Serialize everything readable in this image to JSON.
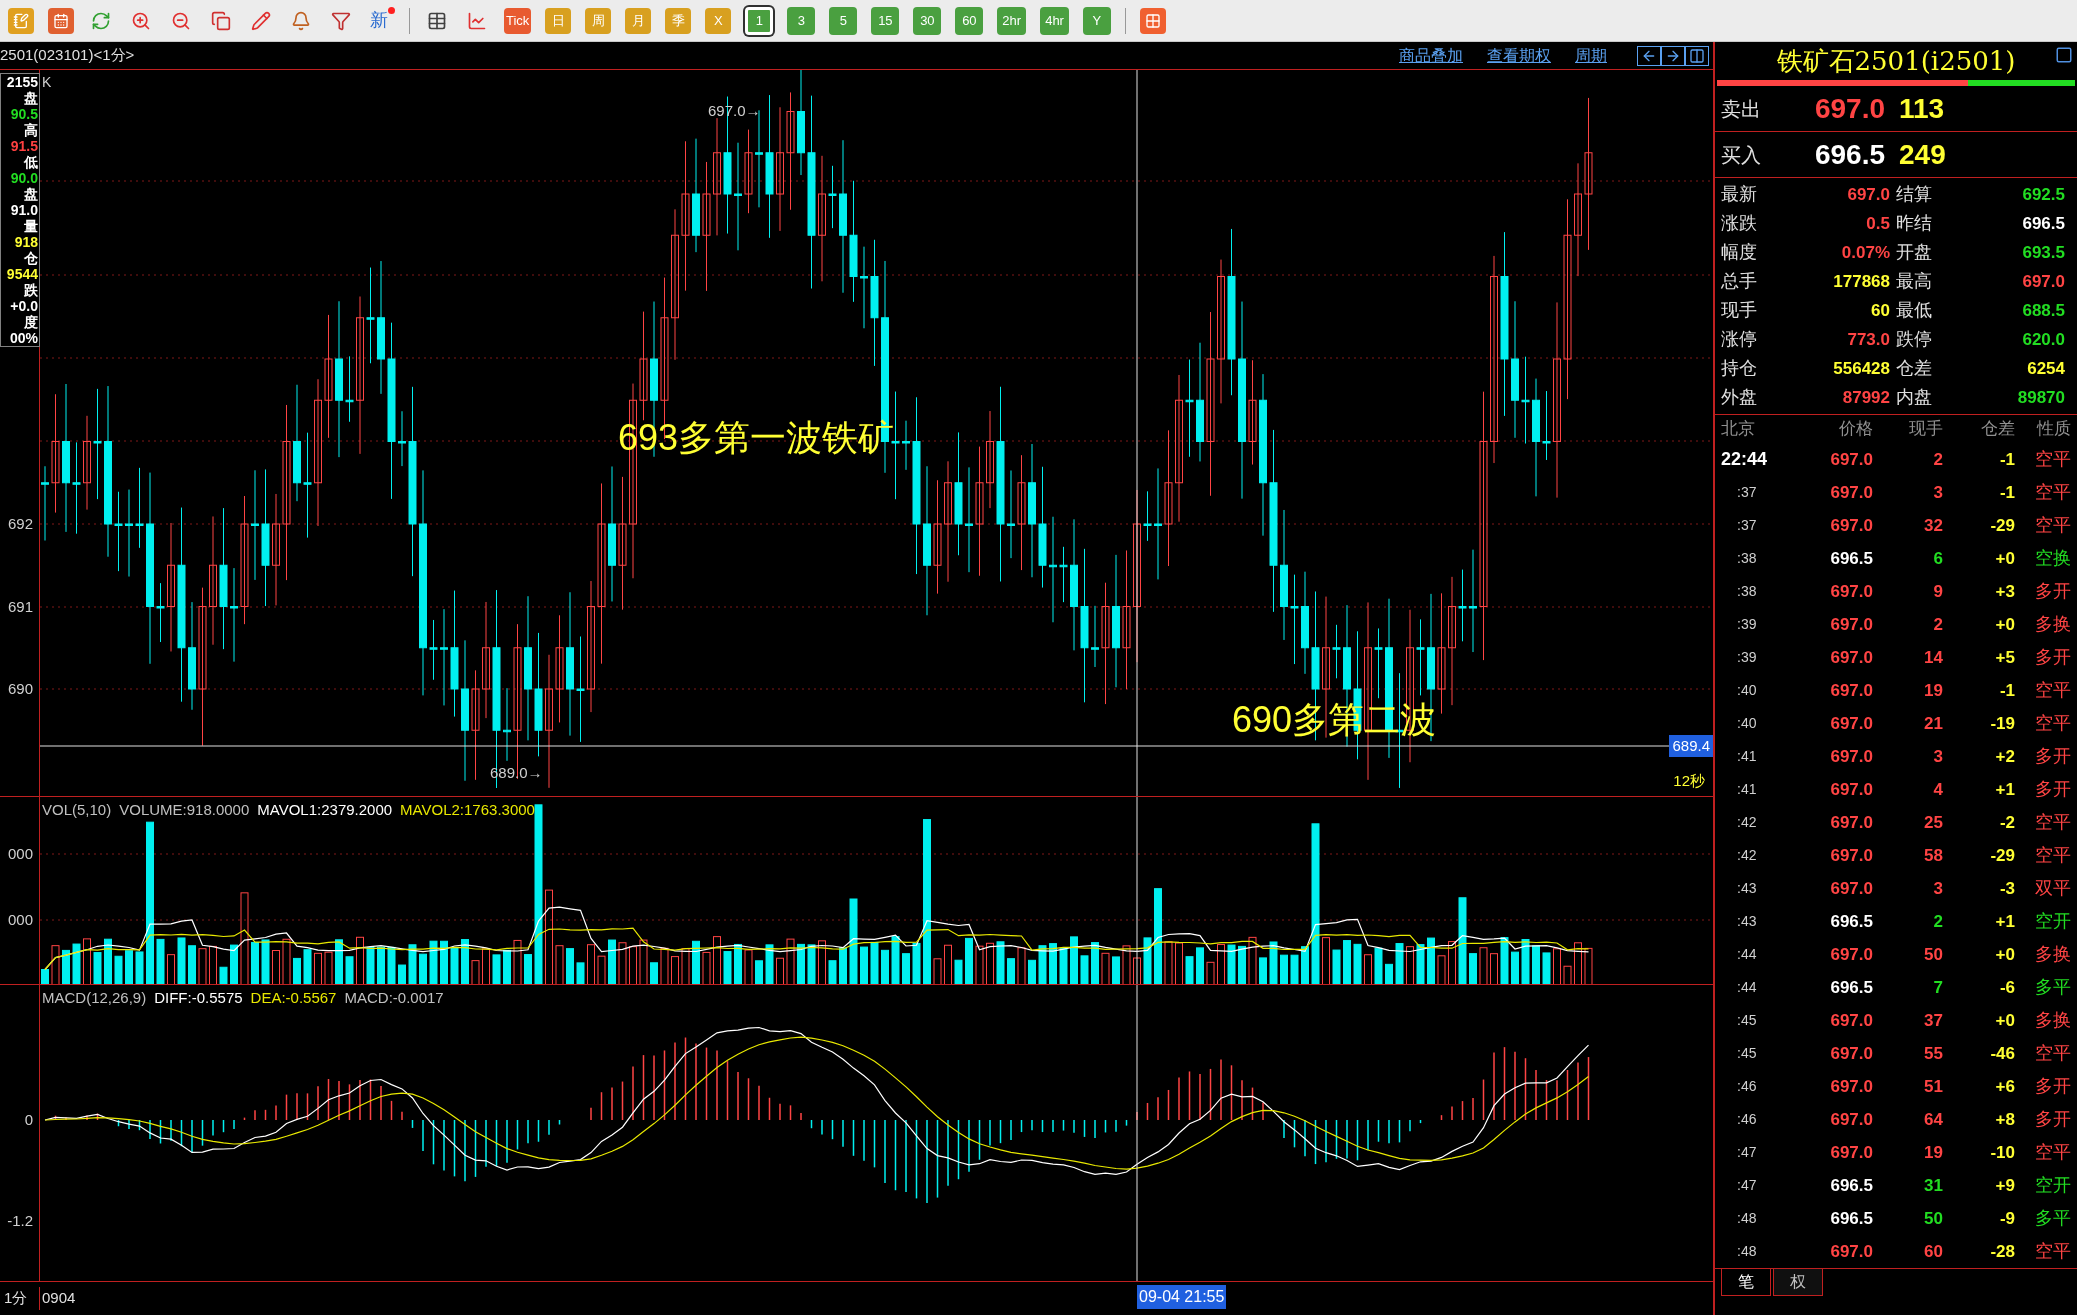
{
  "toolbar": {
    "new_label": "新",
    "chart_buttons": [
      "Tick",
      "日",
      "周",
      "月",
      "季",
      "X"
    ],
    "periods": [
      {
        "label": "1",
        "selected": true
      },
      {
        "label": "3",
        "selected": false
      },
      {
        "label": "5",
        "selected": false
      },
      {
        "label": "15",
        "selected": false
      },
      {
        "label": "30",
        "selected": false
      },
      {
        "label": "60",
        "selected": false
      },
      {
        "label": "2hr",
        "selected": false
      },
      {
        "label": "4hr",
        "selected": false
      },
      {
        "label": "Y",
        "selected": false
      }
    ]
  },
  "chart_header": {
    "symbol": "2501(023101)<1分>",
    "links": [
      "商品叠加",
      "查看期权",
      "周期"
    ]
  },
  "price_panel": {
    "label": "K",
    "info": [
      {
        "text": "2155",
        "color": "#ffffff"
      },
      {
        "text": "盘",
        "color": "#ffffff"
      },
      {
        "text": "90.5",
        "color": "#22dd22"
      },
      {
        "text": "高",
        "color": "#ffffff"
      },
      {
        "text": "91.5",
        "color": "#ff4040"
      },
      {
        "text": "低",
        "color": "#ffffff"
      },
      {
        "text": "90.0",
        "color": "#22dd22"
      },
      {
        "text": "盘",
        "color": "#ffffff"
      },
      {
        "text": "91.0",
        "color": "#ffffff"
      },
      {
        "text": "量",
        "color": "#ffffff"
      },
      {
        "text": "918",
        "color": "#ffff33"
      },
      {
        "text": "仓",
        "color": "#ffffff"
      },
      {
        "text": "9544",
        "color": "#ffff33"
      },
      {
        "text": "跌",
        "color": "#ffffff"
      },
      {
        "text": "+0.0",
        "color": "#ffffff"
      },
      {
        "text": "度",
        "color": "#ffffff"
      },
      {
        "text": "00%",
        "color": "#ffffff"
      }
    ],
    "axis_labels": [
      "692",
      "691",
      "690"
    ],
    "high_marker": "697.0→",
    "low_marker": "689.0→",
    "annotations": [
      "693多第一波铁矿",
      "690多第二波"
    ],
    "crosshair_price": "689.4",
    "countdown": "12秒"
  },
  "volume_panel": {
    "legend": [
      {
        "text": "VOL(5,10)",
        "color": "#c0c0c0"
      },
      {
        "text": "VOLUME:918.0000",
        "color": "#c0c0c0"
      },
      {
        "text": "MAVOL1:2379.2000",
        "color": "#ffffff"
      },
      {
        "text": "MAVOL2:1763.3000",
        "color": "#e8e800"
      }
    ],
    "axis_labels": [
      "000",
      "000"
    ]
  },
  "macd_panel": {
    "legend": [
      {
        "text": "MACD(12,26,9)",
        "color": "#c0c0c0"
      },
      {
        "text": "DIFF:-0.5575",
        "color": "#ffffff"
      },
      {
        "text": "DEA:-0.5567",
        "color": "#e8e800"
      },
      {
        "text": "MACD:-0.0017",
        "color": "#c0c0c0"
      }
    ],
    "axis_labels": [
      "0",
      "-1.2"
    ]
  },
  "bottom_bar": {
    "period": "1分",
    "date": "0904",
    "crosshair_time": "09-04 21:55"
  },
  "quote": {
    "title": "铁矿石2501(i2501)",
    "ratio_bar": {
      "level": 0.7
    },
    "ask": {
      "label": "卖出",
      "price": "697.0",
      "volume": "113"
    },
    "bid": {
      "label": "买入",
      "price": "696.5",
      "volume": "249"
    },
    "stats": [
      {
        "left": {
          "label": "最新",
          "value": "697.0",
          "color": "#ff4444"
        },
        "right": {
          "label": "结算",
          "value": "692.5",
          "color": "#22dd22"
        }
      },
      {
        "left": {
          "label": "涨跌",
          "value": "0.5",
          "color": "#ff4444"
        },
        "right": {
          "label": "昨结",
          "value": "696.5",
          "color": "#ffffff"
        }
      },
      {
        "left": {
          "label": "幅度",
          "value": "0.07%",
          "color": "#ff4444"
        },
        "right": {
          "label": "开盘",
          "value": "693.5",
          "color": "#22dd22"
        }
      },
      {
        "left": {
          "label": "总手",
          "value": "177868",
          "color": "#ffff33"
        },
        "right": {
          "label": "最高",
          "value": "697.0",
          "color": "#ff4444"
        }
      },
      {
        "left": {
          "label": "现手",
          "value": "60",
          "color": "#ffff33"
        },
        "right": {
          "label": "最低",
          "value": "688.5",
          "color": "#22dd22"
        }
      },
      {
        "left": {
          "label": "涨停",
          "value": "773.0",
          "color": "#ff4444"
        },
        "right": {
          "label": "跌停",
          "value": "620.0",
          "color": "#22dd22"
        }
      },
      {
        "left": {
          "label": "持仓",
          "value": "556428",
          "color": "#ffff33"
        },
        "right": {
          "label": "仓差",
          "value": "6254",
          "color": "#ffff33"
        }
      },
      {
        "left": {
          "label": "外盘",
          "value": "87992",
          "color": "#ff4444"
        },
        "right": {
          "label": "内盘",
          "value": "89870",
          "color": "#22dd22"
        }
      }
    ]
  },
  "ticks": {
    "columns": [
      "北京",
      "价格",
      "现手",
      "仓差",
      "性质"
    ],
    "rows": [
      {
        "time": "22:44",
        "price": "697.0",
        "volume": "2",
        "change": "-1",
        "nature": "空平",
        "color": "#ff4444"
      },
      {
        "time": ":37",
        "price": "697.0",
        "volume": "3",
        "change": "-1",
        "nature": "空平",
        "color": "#ff4444"
      },
      {
        "time": ":37",
        "price": "697.0",
        "volume": "32",
        "change": "-29",
        "nature": "空平",
        "color": "#ff4444"
      },
      {
        "time": ":38",
        "price": "696.5",
        "volume": "6",
        "change": "+0",
        "nature": "空换",
        "color": "#22dd22"
      },
      {
        "time": ":38",
        "price": "697.0",
        "volume": "9",
        "change": "+3",
        "nature": "多开",
        "color": "#ff4444"
      },
      {
        "time": ":39",
        "price": "697.0",
        "volume": "2",
        "change": "+0",
        "nature": "多换",
        "color": "#ff4444"
      },
      {
        "time": ":39",
        "price": "697.0",
        "volume": "14",
        "change": "+5",
        "nature": "多开",
        "color": "#ff4444"
      },
      {
        "time": ":40",
        "price": "697.0",
        "volume": "19",
        "change": "-1",
        "nature": "空平",
        "color": "#ff4444"
      },
      {
        "time": ":40",
        "price": "697.0",
        "volume": "21",
        "change": "-19",
        "nature": "空平",
        "color": "#ff4444"
      },
      {
        "time": ":41",
        "price": "697.0",
        "volume": "3",
        "change": "+2",
        "nature": "多开",
        "color": "#ff4444"
      },
      {
        "time": ":41",
        "price": "697.0",
        "volume": "4",
        "change": "+1",
        "nature": "多开",
        "color": "#ff4444"
      },
      {
        "time": ":42",
        "price": "697.0",
        "volume": "25",
        "change": "-2",
        "nature": "空平",
        "color": "#ff4444"
      },
      {
        "time": ":42",
        "price": "697.0",
        "volume": "58",
        "change": "-29",
        "nature": "空平",
        "color": "#ff4444"
      },
      {
        "time": ":43",
        "price": "697.0",
        "volume": "3",
        "change": "-3",
        "nature": "双平",
        "color": "#ff4444"
      },
      {
        "time": ":43",
        "price": "696.5",
        "volume": "2",
        "change": "+1",
        "nature": "空开",
        "color": "#22dd22"
      },
      {
        "time": ":44",
        "price": "697.0",
        "volume": "50",
        "change": "+0",
        "nature": "多换",
        "color": "#ff4444"
      },
      {
        "time": ":44",
        "price": "696.5",
        "volume": "7",
        "change": "-6",
        "nature": "多平",
        "color": "#22dd22"
      },
      {
        "time": ":45",
        "price": "697.0",
        "volume": "37",
        "change": "+0",
        "nature": "多换",
        "color": "#ff4444"
      },
      {
        "time": ":45",
        "price": "697.0",
        "volume": "55",
        "change": "-46",
        "nature": "空平",
        "color": "#ff4444"
      },
      {
        "time": ":46",
        "price": "697.0",
        "volume": "51",
        "change": "+6",
        "nature": "多开",
        "color": "#ff4444"
      },
      {
        "time": ":46",
        "price": "697.0",
        "volume": "64",
        "change": "+8",
        "nature": "多开",
        "color": "#ff4444"
      },
      {
        "time": ":47",
        "price": "697.0",
        "volume": "19",
        "change": "-10",
        "nature": "空平",
        "color": "#ff4444"
      },
      {
        "time": ":47",
        "price": "696.5",
        "volume": "31",
        "change": "+9",
        "nature": "空开",
        "color": "#22dd22"
      },
      {
        "time": ":48",
        "price": "696.5",
        "volume": "50",
        "change": "-9",
        "nature": "多平",
        "color": "#22dd22"
      },
      {
        "time": ":48",
        "price": "697.0",
        "volume": "60",
        "change": "-28",
        "nature": "空平",
        "color": "#ff4444"
      }
    ]
  },
  "tabs": [
    {
      "label": "笔",
      "selected": true
    },
    {
      "label": "权",
      "selected": false
    }
  ]
}
